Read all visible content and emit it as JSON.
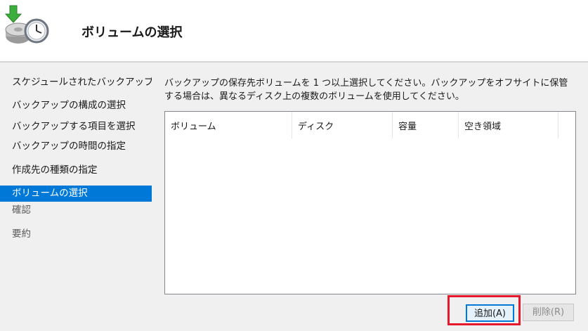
{
  "header": {
    "title": "ボリュームの選択",
    "icon": "backup-clock-drive-icon"
  },
  "sidebar": {
    "items": [
      {
        "label": "スケジュールされたバックアップ..."
      },
      {
        "label": "バックアップの構成の選択"
      },
      {
        "label": "バックアップする項目を選択"
      },
      {
        "label": "バックアップの時間の指定"
      },
      {
        "label": "作成先の種類の指定"
      },
      {
        "label": "ボリュームの選択"
      },
      {
        "label": "確認"
      },
      {
        "label": "要約"
      }
    ],
    "active_index": 5
  },
  "main": {
    "instruction": "バックアップの保存先ボリュームを 1 つ以上選択してください。バックアップをオフサイトに保管する場合は、異なるディスク上の複数のボリュームを使用してください。",
    "columns": [
      "ボリューム",
      "ディスク",
      "容量",
      "空き領域"
    ],
    "rows": []
  },
  "buttons": {
    "add": "追加(A)",
    "remove": "削除(R)"
  },
  "colors": {
    "accent": "#0078d7",
    "highlight": "#e8182c",
    "panel_bg": "#f0f0f0"
  }
}
